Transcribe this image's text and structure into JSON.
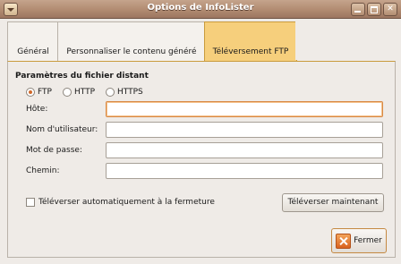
{
  "window": {
    "title": "Options de InfoLister"
  },
  "tabs": [
    {
      "label": "Général"
    },
    {
      "label": "Personnaliser le contenu généré"
    },
    {
      "label": "Téléversement FTP",
      "active": true
    }
  ],
  "remote": {
    "section_title": "Paramètres du fichier distant",
    "protocols": [
      {
        "label": "FTP",
        "selected": true
      },
      {
        "label": "HTTP",
        "selected": false
      },
      {
        "label": "HTTPS",
        "selected": false
      }
    ],
    "fields": {
      "host": {
        "label": "Hôte:",
        "value": ""
      },
      "username": {
        "label": "Nom d'utilisateur:",
        "value": ""
      },
      "password": {
        "label": "Mot de passe:",
        "value": ""
      },
      "path": {
        "label": "Chemin:",
        "value": ""
      }
    }
  },
  "auto_upload": {
    "label": "Téléverser automatiquement à la fermeture",
    "checked": false
  },
  "buttons": {
    "upload_now": "Téléverser maintenant",
    "close": "Fermer"
  },
  "colors": {
    "accent": "#f6cf7c",
    "titlebar": "#b18b71",
    "focus": "#d88a46"
  },
  "icons": {
    "close_button": "x-icon",
    "window_menu": "chevron-down-icon"
  }
}
